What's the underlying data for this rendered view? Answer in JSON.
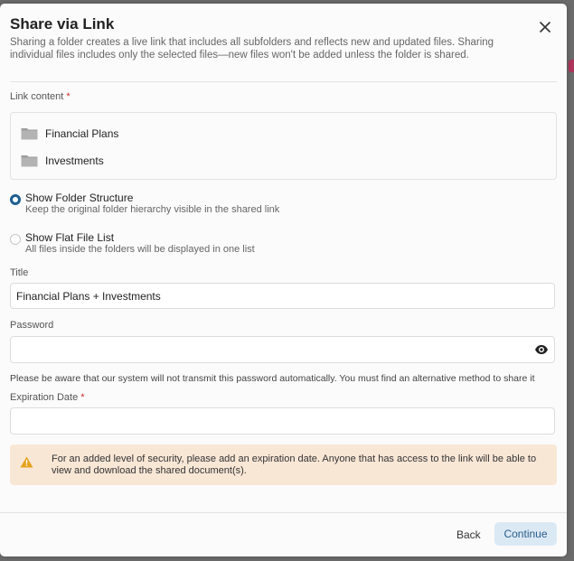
{
  "modal": {
    "title": "Share via Link",
    "subtitle": "Sharing a folder creates a live link that includes all subfolders and reflects new and updated files. Sharing individual files includes only the selected files—new files won't be added unless the folder is shared."
  },
  "link_content": {
    "label": "Link content",
    "required_mark": "*",
    "items": [
      {
        "name": "Financial Plans",
        "icon": "folder-icon"
      },
      {
        "name": "Investments",
        "icon": "folder-icon"
      }
    ]
  },
  "view_options": [
    {
      "title": "Show Folder Structure",
      "description": "Keep the original folder hierarchy visible in the shared link",
      "selected": true
    },
    {
      "title": "Show Flat File List",
      "description": "All files inside the folders will be displayed in one list",
      "selected": false
    }
  ],
  "title_field": {
    "label": "Title",
    "value": "Financial Plans + Investments"
  },
  "password_field": {
    "label": "Password",
    "value": "",
    "toggle_icon": "eye-icon",
    "note": "Please be aware that our system will not transmit this password automatically. You must find an alternative method to share it"
  },
  "expiration_field": {
    "label": "Expiration Date",
    "required_mark": "*",
    "value": ""
  },
  "warning": {
    "icon": "warning-icon",
    "text": "For an added level of security, please add an expiration date. Anyone that has access to the link will be able to view and download the shared document(s)."
  },
  "footer": {
    "back_label": "Back",
    "continue_label": "Continue"
  },
  "colors": {
    "accent": "#1f5f91",
    "required": "#d0302f",
    "warning_bg": "#f9e7d6",
    "warning_icon": "#e6a21d",
    "primary_button_bg": "#dbe9f5"
  }
}
